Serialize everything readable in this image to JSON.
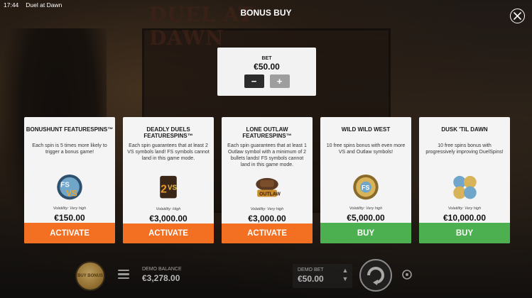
{
  "status_bar": {
    "time": "17:44",
    "app_name": "Duel at Dawn"
  },
  "background": {
    "logo_text": "DUEL AT DAWN"
  },
  "modal": {
    "title": "BONUS BUY",
    "close_icon": "close-icon"
  },
  "bet": {
    "label": "BET",
    "value": "€50.00",
    "minus": "−",
    "plus": "+"
  },
  "cards": [
    {
      "title": "BONUSHUNT FEATURESPINS™",
      "description": "Each spin is 5 times more likely to trigger a bonus game!",
      "icon": "bonushunt-icon",
      "volatility": "Volatility: Very high",
      "price": "€150.00",
      "action": "ACTIVATE",
      "action_color": "#f36f21"
    },
    {
      "title": "DEADLY DUELS FEATURESPINS™",
      "description": "Each spin guarantees that at least 2 VS symbols land! FS symbols cannot land in this game mode.",
      "icon": "deadly-duels-icon",
      "volatility": "Volatility: High",
      "price": "€3,000.00",
      "action": "ACTIVATE",
      "action_color": "#f36f21"
    },
    {
      "title": "LONE OUTLAW FEATURESPINS™",
      "description": "Each spin guarantees that at least 1 Outlaw symbol with a minimum of 2 bullets lands! FS symbols cannot land in this game mode.",
      "icon": "lone-outlaw-icon",
      "volatility": "Volatility: Very high",
      "price": "€3,000.00",
      "action": "ACTIVATE",
      "action_color": "#f36f21"
    },
    {
      "title": "WILD WILD WEST",
      "description": "10 free spins bonus with even more VS and Outlaw symbols!",
      "icon": "wild-wild-west-icon",
      "volatility": "Volatility: Very high",
      "price": "€5,000.00",
      "action": "BUY",
      "action_color": "#4caf50"
    },
    {
      "title": "DUSK 'TIL DAWN",
      "description": "10 free spins bonus with progressively improving DuelSpins!",
      "icon": "dusk-til-dawn-icon",
      "volatility": "Volatility: Very high",
      "price": "€10,000.00",
      "action": "BUY",
      "action_color": "#4caf50"
    }
  ],
  "bottom": {
    "bonus_buy_text": "BUY BONUS",
    "balance_label": "DEMO BALANCE",
    "balance_value": "€3,278.00",
    "demo_bet_label": "DEMO BET",
    "demo_bet_value": "€50.00"
  }
}
